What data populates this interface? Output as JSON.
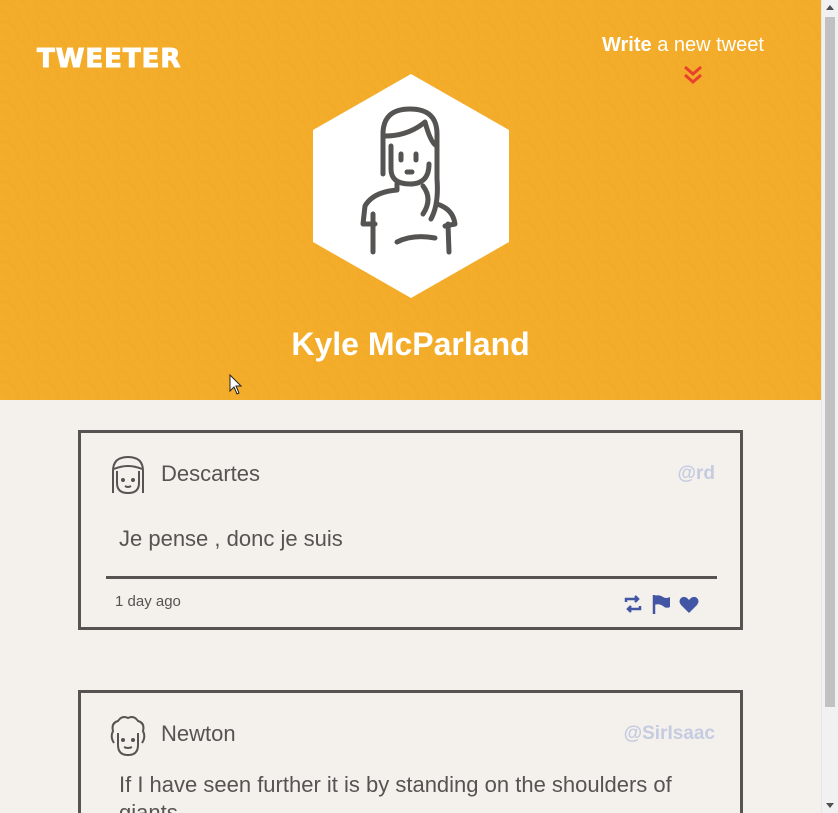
{
  "header": {
    "logo": "TWEETER",
    "compose_bold": "Write",
    "compose_rest": " a new tweet",
    "profile_name": "Kyle McParland"
  },
  "colors": {
    "header_bg": "#f4ad2b",
    "accent_arrow": "#e8412c",
    "action_icons": "#4356a6",
    "border": "#555452",
    "handle": "#c5cbe0"
  },
  "tweets": [
    {
      "name": "Descartes",
      "handle": "@rd",
      "text": "Je pense , donc je suis",
      "time": "1 day ago",
      "avatar_icon": "girl-avatar-icon",
      "actions": [
        "retweet-icon",
        "flag-icon",
        "heart-icon"
      ]
    },
    {
      "name": "Newton",
      "handle": "@SirIsaac",
      "text": "If I have seen further it is by standing on the shoulders of giants"
    }
  ]
}
